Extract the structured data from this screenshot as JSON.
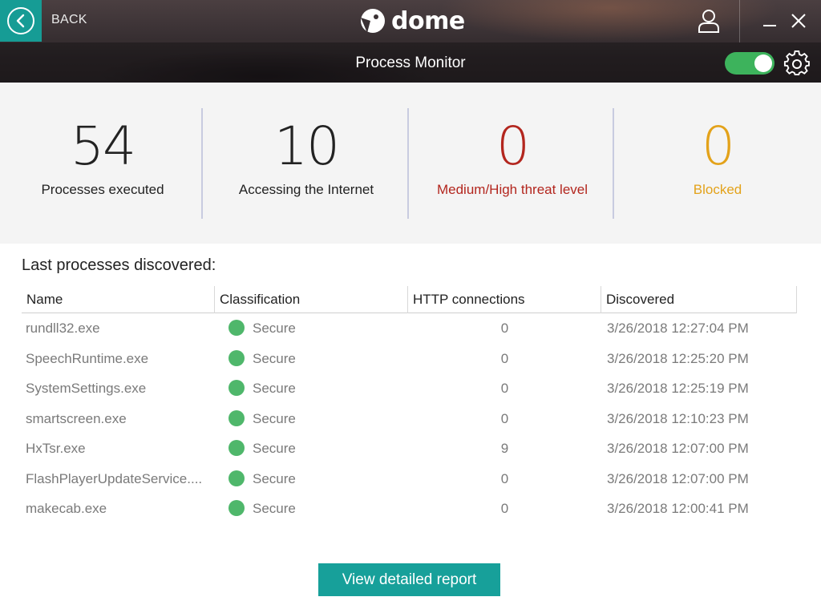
{
  "header": {
    "back_label": "BACK",
    "logo_text": "dome",
    "page_title": "Process Monitor",
    "toggle_on": true,
    "colors": {
      "accent": "#169c95",
      "toggle": "#3db35c"
    }
  },
  "stats": [
    {
      "value": "54",
      "label": "Processes executed",
      "color": "#222222"
    },
    {
      "value": "10",
      "label": "Accessing the Internet",
      "color": "#222222"
    },
    {
      "value": "0",
      "label": "Medium/High threat level",
      "color": "#b3261e"
    },
    {
      "value": "0",
      "label": "Blocked",
      "color": "#e3a21a"
    }
  ],
  "table": {
    "title": "Last processes discovered:",
    "columns": [
      "Name",
      "Classification",
      "HTTP connections",
      "Discovered"
    ],
    "rows": [
      {
        "name": "rundll32.exe",
        "classification": "Secure",
        "http": "0",
        "discovered": "3/26/2018 12:27:04 PM"
      },
      {
        "name": "SpeechRuntime.exe",
        "classification": "Secure",
        "http": "0",
        "discovered": "3/26/2018 12:25:20 PM"
      },
      {
        "name": "SystemSettings.exe",
        "classification": "Secure",
        "http": "0",
        "discovered": "3/26/2018 12:25:19 PM"
      },
      {
        "name": "smartscreen.exe",
        "classification": "Secure",
        "http": "0",
        "discovered": "3/26/2018 12:10:23 PM"
      },
      {
        "name": "HxTsr.exe",
        "classification": "Secure",
        "http": "9",
        "discovered": "3/26/2018 12:07:00 PM"
      },
      {
        "name": "FlashPlayerUpdateService....",
        "classification": "Secure",
        "http": "0",
        "discovered": "3/26/2018 12:07:00 PM"
      },
      {
        "name": "makecab.exe",
        "classification": "Secure",
        "http": "0",
        "discovered": "3/26/2018 12:00:41 PM"
      }
    ]
  },
  "footer": {
    "report_button": "View detailed report"
  },
  "icons": {
    "back": "chevron-left-icon",
    "user": "user-icon",
    "minimize": "minimize-icon",
    "close": "close-icon",
    "settings": "gear-icon",
    "status": "secure-dot-icon"
  }
}
